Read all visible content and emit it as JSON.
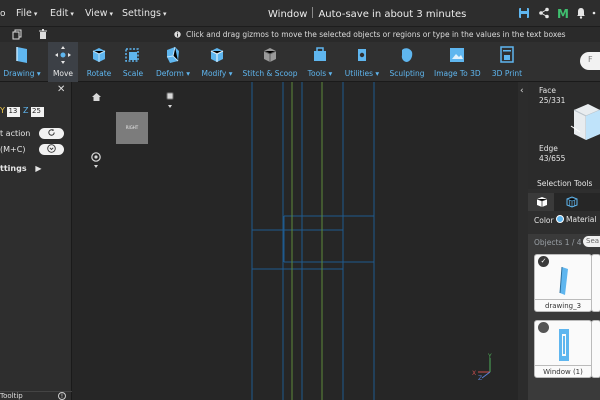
{
  "menu": {
    "items": [
      "File",
      "Edit",
      "View",
      "Settings"
    ],
    "window_title": "Window",
    "autosave": "Auto-save in about 3 minutes"
  },
  "hint": "Click and drag gizmos to move the selected objects or regions or type in the values in the text boxes",
  "toolbar": {
    "tools": [
      {
        "label": "Drawing",
        "icon": "drawing-icon",
        "dropdown": true
      },
      {
        "label": "Move",
        "icon": "move-icon",
        "active": true
      },
      {
        "label": "Rotate",
        "icon": "rotate-icon"
      },
      {
        "label": "Scale",
        "icon": "scale-icon"
      },
      {
        "label": "Deform",
        "icon": "deform-icon",
        "dropdown": true
      },
      {
        "label": "Modify",
        "icon": "modify-icon",
        "dropdown": true
      },
      {
        "label": "Stitch & Scoop",
        "icon": "stitch-scoop-icon"
      },
      {
        "label": "Tools",
        "icon": "tools-icon",
        "dropdown": true
      },
      {
        "label": "Utilities",
        "icon": "utilities-icon",
        "dropdown": true
      },
      {
        "label": "Sculpting",
        "icon": "sculpting-icon"
      },
      {
        "label": "Image To 3D",
        "icon": "image-to-3d-icon"
      },
      {
        "label": "3D Print",
        "icon": "3d-print-icon"
      }
    ],
    "search_partial": "F"
  },
  "left_panel": {
    "y_label": "Y",
    "y_value": "13",
    "z_label": "Z",
    "z_value": "25",
    "action_label": "t action",
    "shortcut_label": "(M+C)",
    "settings_label": "ttings",
    "footer_label": "Tooltip"
  },
  "viewport": {
    "navcube_label": "RIGHT",
    "axis_x": "X",
    "axis_y": "Y",
    "axis_z": "Z"
  },
  "right_panel": {
    "face_label": "Face",
    "face_count": "25/331",
    "edge_label": "Edge",
    "edge_count": "43/655",
    "selection_tools": "Selection Tools",
    "color_label": "Color",
    "material_label": "Material",
    "objects_count": "Objects 1 / 4",
    "search_partial": "Sea",
    "cards": [
      "drawing_3",
      "Window (1)"
    ]
  },
  "colors": {
    "accent_blue": "#5fb6ef",
    "green_m": "#3fbf6f",
    "axis_yellow": "#f0c94a",
    "line_blue": "#1f5a8e",
    "line_green": "#5f8a3a"
  }
}
